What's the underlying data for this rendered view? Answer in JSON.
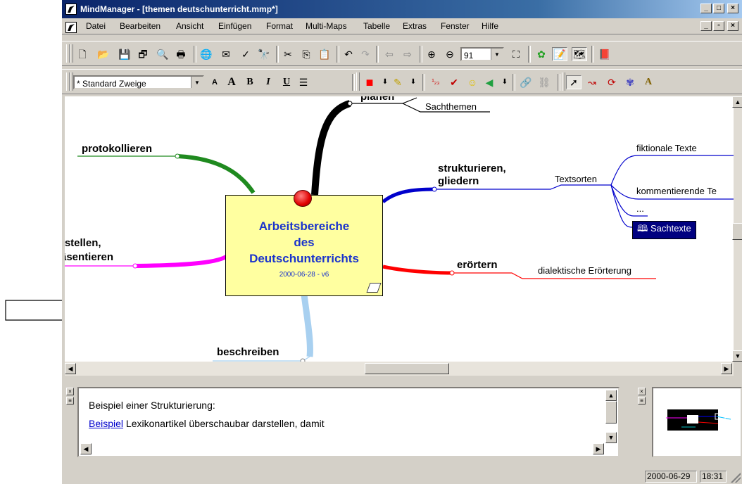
{
  "window": {
    "title": "MindManager - [themen deutschunterricht.mmp*]",
    "caption_buttons": [
      "_",
      "□",
      "×"
    ],
    "mdi_buttons": [
      "_",
      "▫",
      "×"
    ]
  },
  "menu": [
    "Datei",
    "Bearbeiten",
    "Ansicht",
    "Einfügen",
    "Format",
    "Multi-Maps",
    "Tabelle",
    "Extras",
    "Fenster",
    "Hilfe"
  ],
  "toolbar1": {
    "icons": [
      "new-document-icon",
      "open-folder-icon",
      "save-icon",
      "save-all-icon",
      "print-preview-icon",
      "print-icon",
      "web-globe-icon",
      "send-mail-icon",
      "spellcheck-icon",
      "find-icon",
      "cut-icon",
      "copy-icon",
      "paste-icon",
      "undo-icon",
      "redo-icon",
      "back-arrow-icon",
      "forward-arrow-icon",
      "zoom-in-icon",
      "zoom-out-icon",
      "fit-page-icon",
      "colors-icon",
      "notes-view-icon",
      "overview-icon",
      "book-icon"
    ],
    "zoom_value": "91"
  },
  "toolbar2": {
    "style_value": "* Standard Zweige",
    "format_buttons": [
      "A",
      "A",
      "B",
      "I",
      "U"
    ],
    "icons": [
      "text-format-icon",
      "font-size-down-icon",
      "font-size-up-icon",
      "bold-icon",
      "italic-icon",
      "underline-icon",
      "align-icon",
      "fill-color-icon",
      "fill-dropdown-icon",
      "highlight-pen-icon",
      "highlight-dropdown-icon",
      "numbering-icon",
      "checkmark-icon",
      "smiley-icon",
      "flag-icon",
      "flag-dropdown-icon",
      "hyperlink-icon",
      "unlink-icon",
      "select-pointer-icon",
      "relationship-icon",
      "boundary-icon",
      "image-library-icon",
      "text-style-icon"
    ]
  },
  "map": {
    "central": {
      "line1": "Arbeitsbereiche",
      "line2": "des",
      "line3": "Deutschunterrichts",
      "date": "2000-06-28 - v6"
    },
    "branches": {
      "planen": "planen",
      "sachthemen": "Sachthemen",
      "protokollieren": "protokollieren",
      "strukturieren1": "strukturieren,",
      "strukturieren2": "gliedern",
      "textsorten": "Textsorten",
      "fiktionale": "fiktionale Texte",
      "kommentierende": "kommentierende Te",
      "ellipsis": "...",
      "sachtexte": "Sachtexte",
      "darstellen1": "rstellen,",
      "darstellen2": "äsentieren",
      "eroertern": "erörtern",
      "dialektische": "dialektische Erörterung",
      "beschreiben": "beschreiben"
    },
    "colors": {
      "central_fill": "#ffffa0",
      "central_text": "#1a33cc",
      "planen": "#000000",
      "protokollieren": "#1f8a1f",
      "strukturieren": "#0000cc",
      "darstellen": "#ff00ff",
      "eroertern": "#ff0000",
      "beschreiben": "#a8d0f0",
      "sachtexte_bg": "#000080"
    }
  },
  "notes": {
    "line1": "Beispiel einer Strukturierung:",
    "link": "Beispiel",
    "line2_rest": " Lexikonartikel überschaubar darstellen, damit"
  },
  "status": {
    "date": "2000-06-29",
    "time": "18:31"
  },
  "arrow": "right-arrow-pointer"
}
